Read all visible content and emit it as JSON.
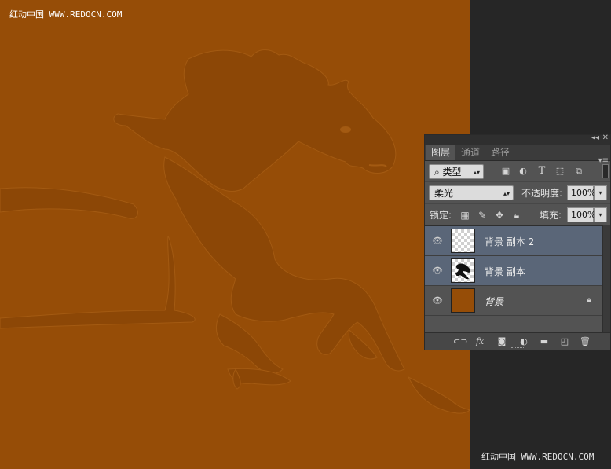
{
  "watermark": {
    "top": "红动中国 WWW.REDOCN.COM",
    "bottom": "红动中国 WWW.REDOCN.COM"
  },
  "canvas": {
    "background": "#964d07",
    "artwork_color": "#8a4506"
  },
  "layers_panel": {
    "tabs": [
      {
        "label": "图层",
        "active": true
      },
      {
        "label": "通道",
        "active": false
      },
      {
        "label": "路径",
        "active": false
      }
    ],
    "filter": {
      "kind": "类型",
      "icons": [
        "image-filter-icon",
        "adjustment-filter-icon",
        "type-filter-icon",
        "shape-filter-icon",
        "smart-object-filter-icon"
      ]
    },
    "blend_mode": "柔光",
    "opacity_label": "不透明度:",
    "opacity_value": "100%",
    "lock_label": "锁定:",
    "lock_icons": [
      "lock-transparent-icon",
      "lock-paint-icon",
      "lock-move-icon",
      "lock-all-icon"
    ],
    "fill_label": "填充:",
    "fill_value": "100%",
    "layers": [
      {
        "name": "背景 副本 2",
        "visible": true,
        "selected": true,
        "thumbnail": "transparent"
      },
      {
        "name": "背景 副本",
        "visible": true,
        "selected": true,
        "thumbnail": "horse"
      },
      {
        "name": "背景",
        "visible": true,
        "selected": false,
        "thumbnail": "fill",
        "locked": true
      }
    ],
    "bottom_icons": [
      "link-icon",
      "fx-icon",
      "mask-icon",
      "adjustment-icon",
      "group-icon",
      "new-layer-icon",
      "trash-icon"
    ]
  }
}
